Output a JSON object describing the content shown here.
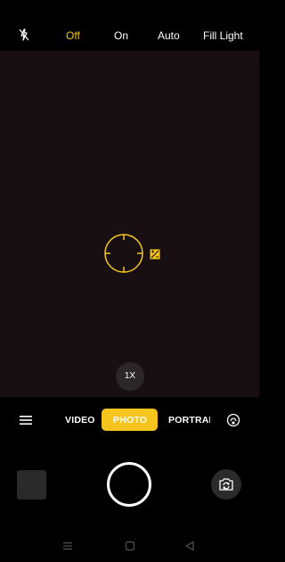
{
  "flash": {
    "options": [
      "Off",
      "On",
      "Auto",
      "Fill Light"
    ],
    "selected": "Off"
  },
  "zoom": "1X",
  "modes": {
    "items": [
      "VIDEO",
      "PHOTO",
      "PORTRAIT"
    ],
    "selected": "PHOTO"
  },
  "colors": {
    "accent": "#f5c51e",
    "viewfinder": "#170f11",
    "background": "#000000"
  },
  "icons": {
    "flash": "flash-off-icon",
    "focus": "focus-ring-icon",
    "exposure": "exposure-icon",
    "menu": "menu-icon",
    "lens": "lens-icon",
    "switch": "switch-camera-icon",
    "gallery": "gallery-thumbnail",
    "nav": [
      "recent-apps-icon",
      "home-icon",
      "back-icon"
    ]
  }
}
